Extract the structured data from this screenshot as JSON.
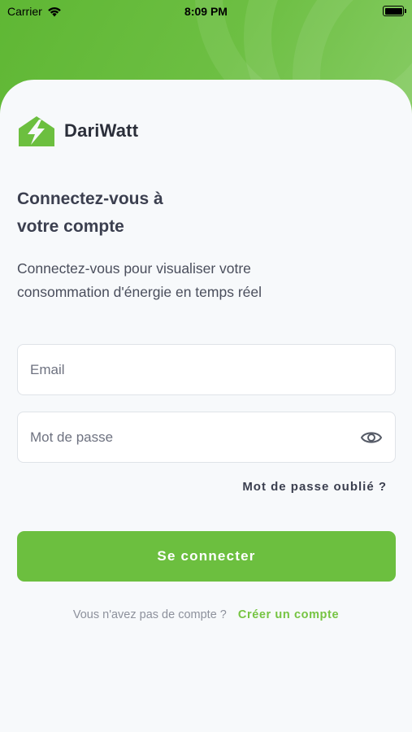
{
  "status_bar": {
    "carrier": "Carrier",
    "time": "8:09 PM"
  },
  "brand": {
    "name": "DariWatt",
    "accent_color": "#6cbf3f",
    "logo_icon": "house-lightning-icon"
  },
  "login": {
    "title_line1": "Connectez-vous à",
    "title_line2": "votre compte",
    "subtitle_line1": "Connectez-vous pour visualiser votre",
    "subtitle_line2": "consommation d'énergie en temps réel",
    "email_placeholder": "Email",
    "password_placeholder": "Mot de passe",
    "forgot_password": "Mot de passe oublié ?",
    "submit_label": "Se connecter",
    "no_account_prompt": "Vous n'avez pas de compte ?",
    "create_account_link": "Créer un compte"
  }
}
